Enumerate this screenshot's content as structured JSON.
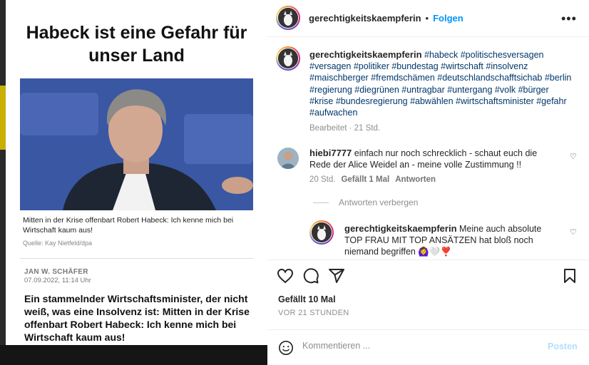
{
  "post_image": {
    "headline": "Habeck ist eine Gefahr für unser Land",
    "caption": "Mitten in der Krise offenbart Robert Habeck: Ich kenne mich bei Wirtschaft kaum aus!",
    "source": "Quelle: Kay Nietfeld/dpa",
    "author": "JAN W. SCHÄFER",
    "date": "07.09.2022, 11:14 Uhr",
    "lead": "Ein stammelnder Wirtschaftsminister, der nicht weiß, was eine Insolvenz ist: Mitten in der Krise offenbart Robert Habeck: Ich kenne mich bei Wirtschaft kaum aus!"
  },
  "header": {
    "username": "gerechtigkeitskaempferin",
    "separator": "•",
    "follow_label": "Folgen",
    "more_label": "•••"
  },
  "post_caption": {
    "username": "gerechtigkeitskaempferin",
    "hashtags": "#habeck #politischesversagen #versagen #politiker #bundestag #wirtschaft #insolvenz #maischberger #fremdschämen #deutschlandschafftsichab #berlin #regierung #diegrünen #untragbar #untergang #volk #bürger #krise #bundesregierung #abwählen #wirtschaftsminister #gefahr #aufwachen",
    "meta": "Bearbeitet · 21 Std."
  },
  "comments": [
    {
      "username": "hiebi7777",
      "text": "einfach nur noch schrecklich - schaut euch die Rede der Alice Weidel an - meine volle Zustimmung !!",
      "time": "20 Std.",
      "likes": "Gefällt 1 Mal",
      "reply_label": "Antworten"
    }
  ],
  "hide_replies_label": "Antworten verbergen",
  "reply": {
    "username": "gerechtigkeitskaempferin",
    "text": "Meine auch absolute TOP FRAU MIT TOP ANSÄTZEN hat bloß noch niemand begriffen 🙆‍♀️🤍❣️"
  },
  "actions": {
    "like_icon": "heart-icon",
    "comment_icon": "comment-icon",
    "share_icon": "send-icon",
    "save_icon": "bookmark-icon"
  },
  "likes_text": "Gefällt 10 Mal",
  "time_ago": "VOR 21 STUNDEN",
  "comment_box": {
    "placeholder": "Kommentieren ...",
    "post_label": "Posten"
  },
  "colors": {
    "link": "#0095f6",
    "hashtag": "#00376b",
    "muted": "#8e8e8e",
    "post_disabled": "#b2dffc"
  }
}
